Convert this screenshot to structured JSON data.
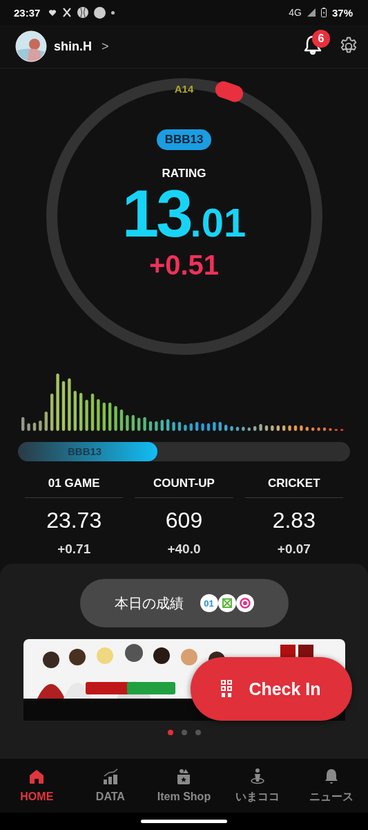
{
  "status_bar": {
    "time": "23:37",
    "network": "4G",
    "battery": "37%"
  },
  "header": {
    "user_name": "shin.H",
    "chevron": ">",
    "notification_count": "6"
  },
  "gauge": {
    "next_rank": "A14",
    "rank_badge": "BBB13",
    "label": "RATING",
    "rating_integer": "13",
    "rating_decimal": ".01",
    "change": "+0.51"
  },
  "rank_bar": {
    "label": "BBB13",
    "level": 0.42
  },
  "stats": [
    {
      "title": "01 GAME",
      "value": "23.73",
      "change": "+0.71"
    },
    {
      "title": "COUNT-UP",
      "value": "609",
      "change": "+40.0"
    },
    {
      "title": "CRICKET",
      "value": "2.83",
      "change": "+0.07"
    }
  ],
  "today_button": {
    "label": "本日の成績",
    "badges": [
      {
        "kind": "text",
        "text": "01",
        "color": "#2a8fe0"
      },
      {
        "kind": "cross",
        "color": "#5cb83c"
      },
      {
        "kind": "target",
        "color": "#e0358a"
      }
    ]
  },
  "carousel_dots": [
    {
      "selected": true
    },
    {
      "selected": false
    },
    {
      "selected": false
    }
  ],
  "check_in": {
    "label": "Check In"
  },
  "tabs": [
    {
      "label": "HOME",
      "kind": "home",
      "selected": true
    },
    {
      "label": "DATA",
      "kind": "data",
      "selected": false
    },
    {
      "label": "Item Shop",
      "kind": "shop",
      "selected": false
    },
    {
      "label": "いまココ",
      "kind": "here",
      "selected": false
    },
    {
      "label": "ニュース",
      "kind": "news",
      "selected": false
    }
  ]
}
